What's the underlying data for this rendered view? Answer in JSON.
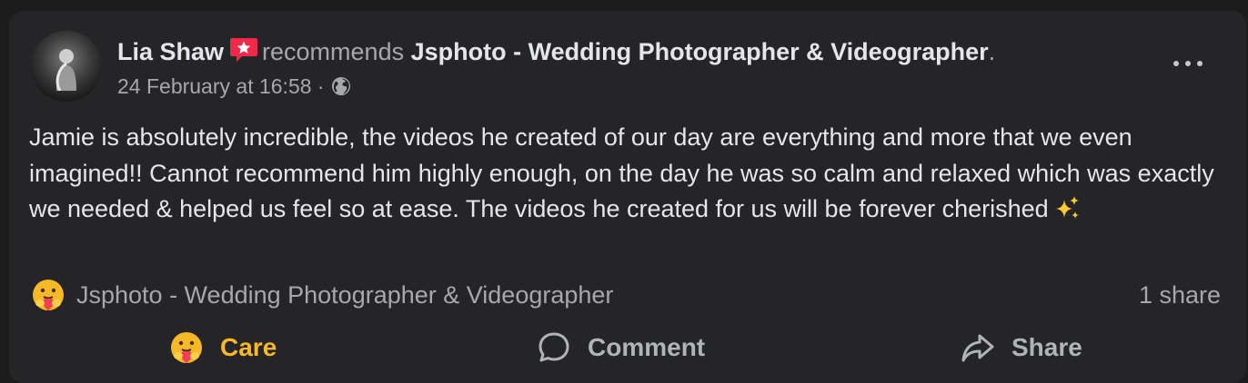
{
  "post": {
    "author": "Lia Shaw",
    "verb": "recommends",
    "page": "Jsphoto - Wedding Photographer & Videographer",
    "period": ".",
    "timestamp": "24 February at 16:58",
    "separator": "·",
    "privacy_icon": "globe-icon",
    "badge_icon": "recommendation-star-icon",
    "menu_icon": "more-options-icon",
    "text": "Jamie is absolutely incredible, the videos he created of our day are everything and more that we even imagined!! Cannot recommend him highly enough, on the day he was so calm and relaxed which was exactly we needed & helped us feel so at ease. The videos he created for us will be forever cherished",
    "text_emoji": "sparkles-icon"
  },
  "reactions": {
    "reactor": "Jsphoto - Wedding Photographer & Videographer",
    "reaction_icon": "care-emoji-icon",
    "share_count": "1 share"
  },
  "actions": {
    "care_label": "Care",
    "comment_label": "Comment",
    "share_label": "Share"
  },
  "colors": {
    "background": "#1c1c1d",
    "card": "#252527",
    "primary_text": "#e4e6eb",
    "secondary_text": "#a6a8ac",
    "care_active": "#f7b928",
    "badge": "#f02849"
  }
}
